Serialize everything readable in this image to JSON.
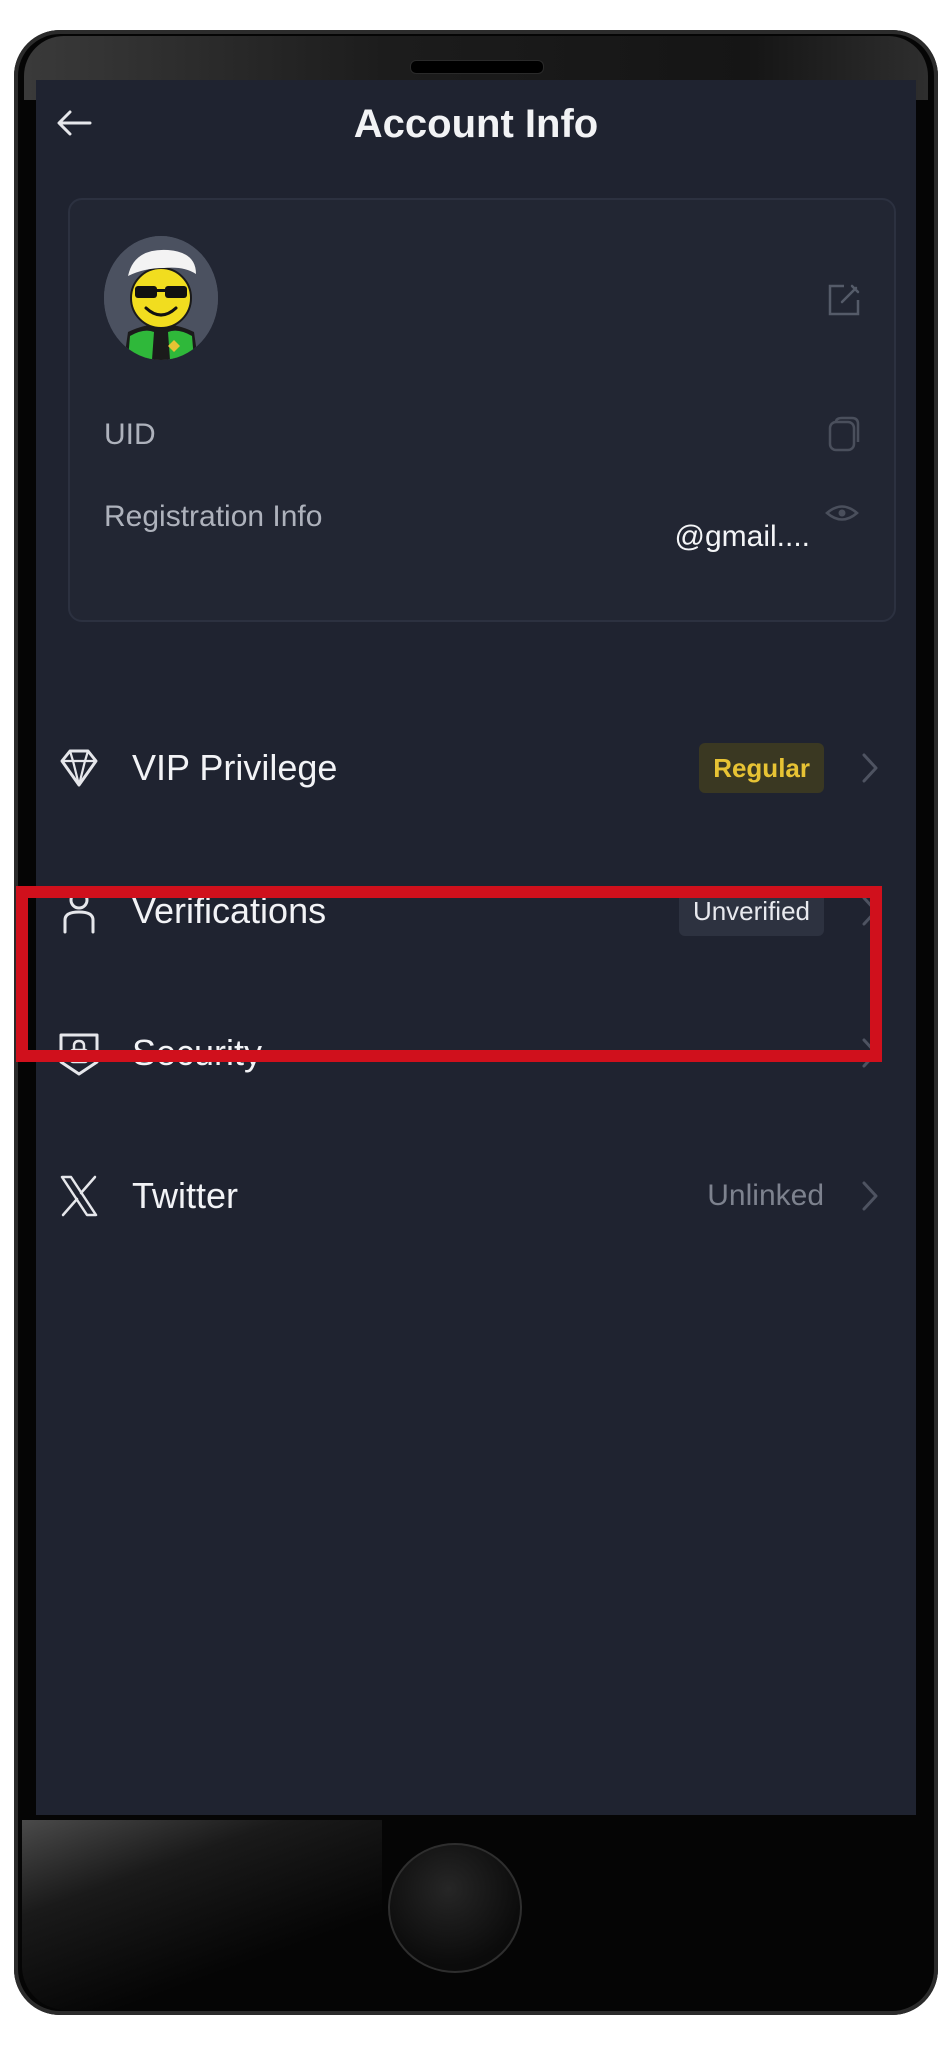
{
  "header": {
    "title": "Account Info"
  },
  "profile": {
    "uid_label": "UID",
    "registration_label": "Registration Info",
    "registration_value": "@gmail...."
  },
  "menu": {
    "items": [
      {
        "label": "VIP Privilege",
        "status": "Regular",
        "icon": "diamond-icon"
      },
      {
        "label": "Verifications",
        "status": "Unverified",
        "icon": "person-icon"
      },
      {
        "label": "Security",
        "status": "",
        "icon": "shield-lock-icon"
      },
      {
        "label": "Twitter",
        "status": "Unlinked",
        "icon": "x-logo-icon"
      }
    ]
  },
  "highlight": {
    "target": "Security",
    "color": "#d0101c"
  },
  "colors": {
    "background": "#1f2330",
    "vip_badge_text": "#e7c334",
    "text": "#f2f3f6"
  }
}
